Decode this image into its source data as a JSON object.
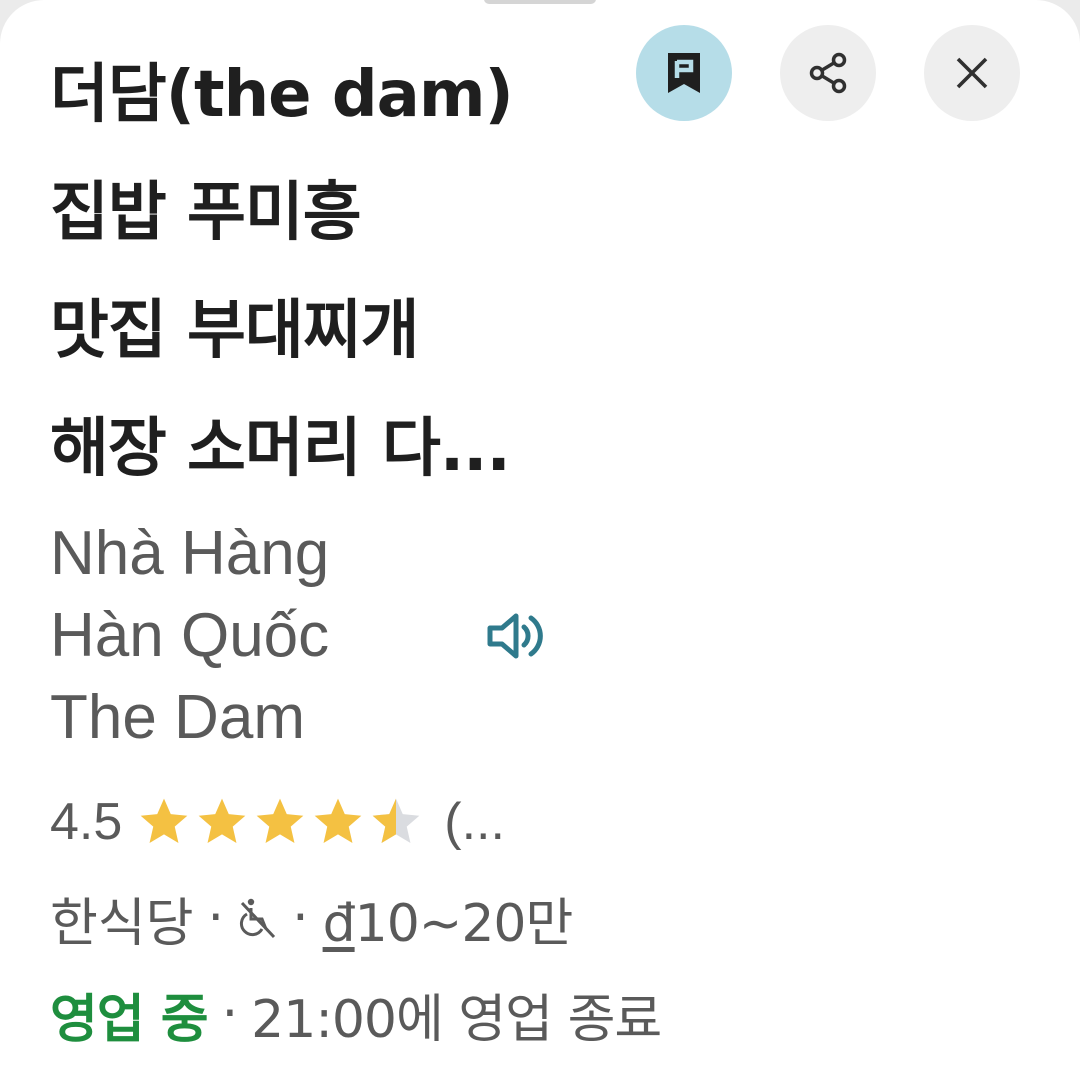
{
  "place": {
    "title": "더담(the dam)\n집밥 푸미흥\n맛집 부대찌개\n해장 소머리 다...",
    "translated_name": "Nhà Hàng\nHàn Quốc\nThe Dam",
    "rating": "4.5",
    "rating_value": 4.5,
    "rating_max": 5,
    "review_count": "(...",
    "category": "한식당",
    "separator": "·",
    "price_symbol": "đ",
    "price_range": "10~20만",
    "open_status": "영업 중",
    "hours_text": "21:00에 영업 종료"
  },
  "icons": {
    "save": "bookmark-flag-icon",
    "share": "share-icon",
    "close": "close-icon",
    "speaker": "speaker-icon",
    "accessibility": "wheelchair-not-accessible-icon",
    "star": "star-icon"
  },
  "colors": {
    "star": "#f4c142",
    "star_empty": "#dadce0",
    "open": "#1e8e3e",
    "saved_button_bg": "#b6dde8",
    "speaker": "#2f7a8c"
  }
}
